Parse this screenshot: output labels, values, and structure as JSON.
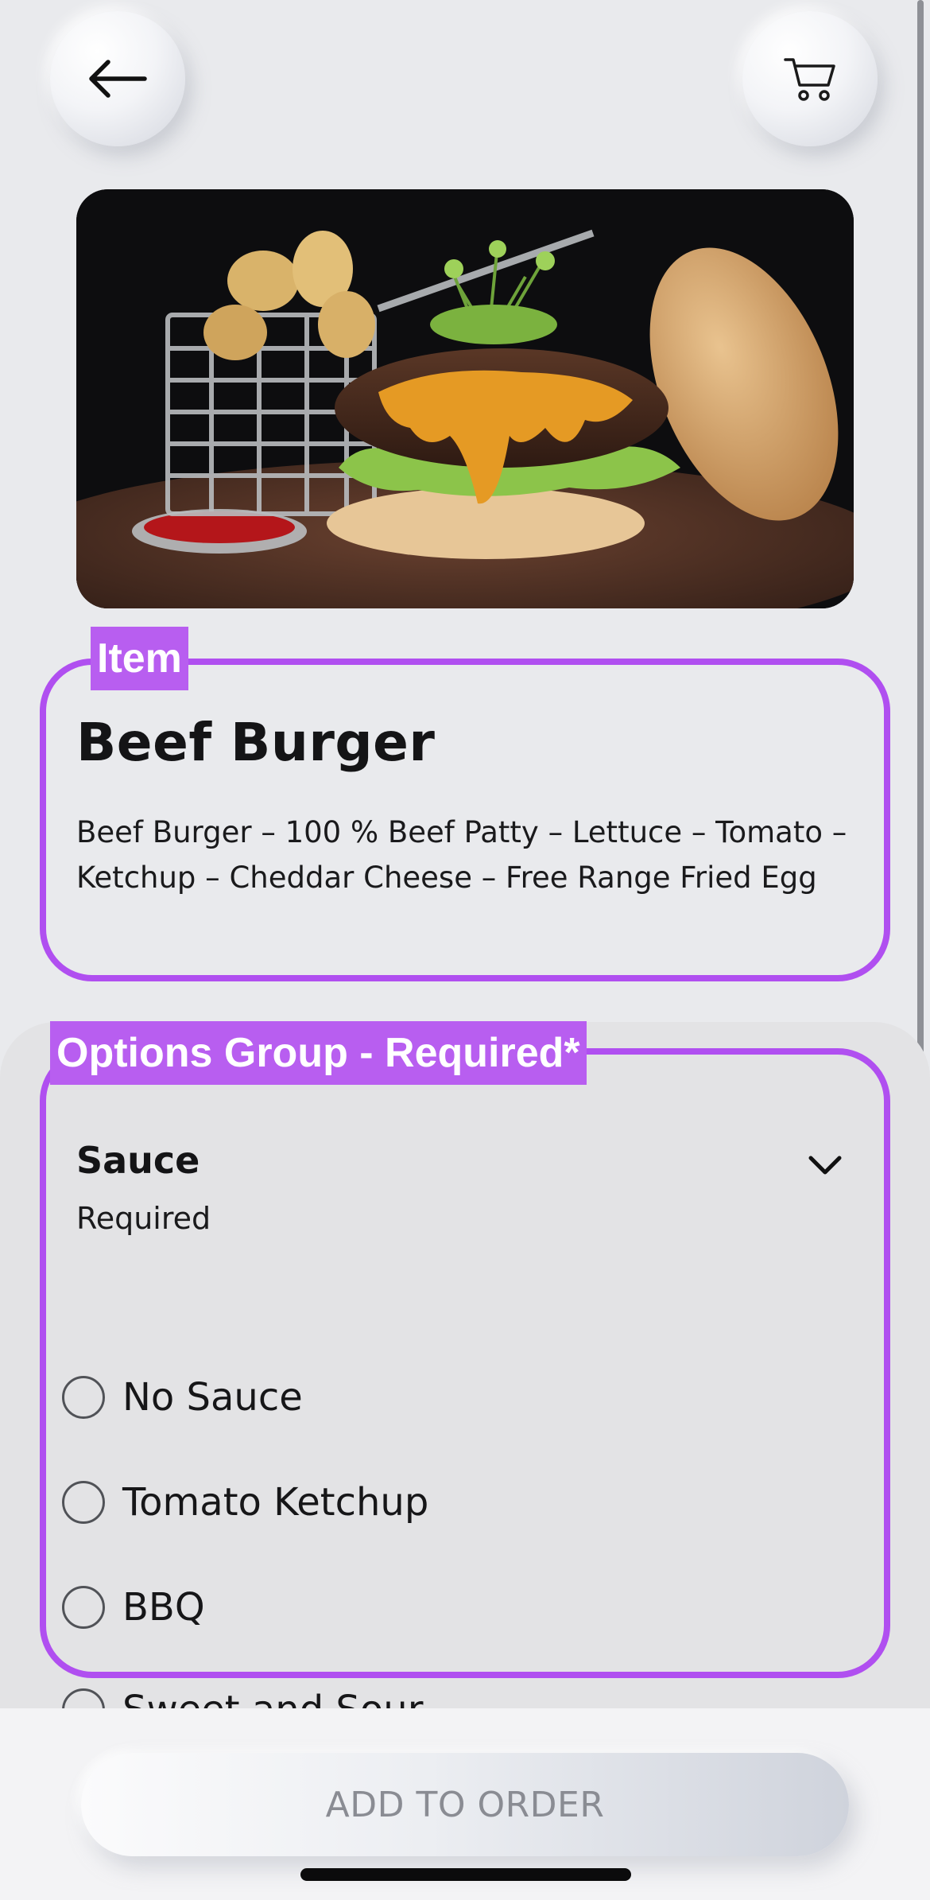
{
  "header": {
    "back_icon": "arrow-left-icon",
    "cart_icon": "cart-icon"
  },
  "hero": {
    "image": "beef-burger-photo"
  },
  "annotations": {
    "item_tag": "Item",
    "options_tag": "Options Group - Required*",
    "color": "#b85ef0"
  },
  "item": {
    "title": "Beef Burger",
    "description": "Beef Burger – 100 % Beef Patty – Lettuce – Tomato – Ketchup – Cheddar Cheese – Free Range Fried Egg"
  },
  "options_group": {
    "title": "Sauce",
    "subtitle": "Required",
    "expand_icon": "chevron-down-icon",
    "options": [
      {
        "label": "No Sauce",
        "selected": false
      },
      {
        "label": "Tomato Ketchup",
        "selected": false
      },
      {
        "label": "BBQ",
        "selected": false
      },
      {
        "label": "Sweet and Sour",
        "selected": false
      }
    ]
  },
  "footer": {
    "add_button_label": "ADD TO ORDER"
  }
}
